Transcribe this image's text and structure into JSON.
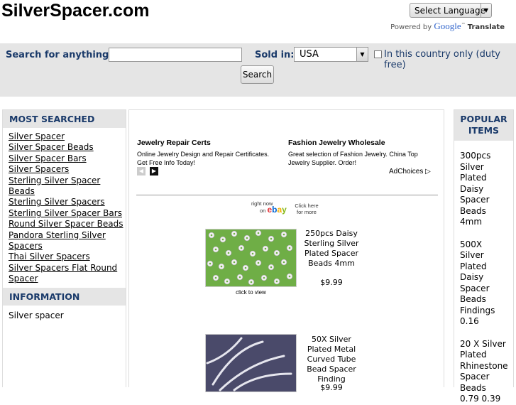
{
  "header": {
    "site_title": "SilverSpacer.com",
    "language_label": "Select Language",
    "powered_by": "Powered by",
    "google": "Google",
    "translate": "Translate"
  },
  "search": {
    "label": "Search for anything:",
    "input_value": "",
    "sold_in_label": "Sold in:",
    "country": "USA",
    "checkbox_label": "In this country only (duty free)",
    "button_label": "Search"
  },
  "sidebar": {
    "most_searched_title": "MOST SEARCHED",
    "links": [
      "Silver Spacer",
      "Silver Spacer Beads",
      "Silver Spacer Bars",
      "Silver Spacers",
      "Sterling Silver Spacer Beads",
      "Sterling Silver Spacers",
      "Sterling Silver Spacer Bars",
      "Round Silver Spacer Beads",
      "Pandora Sterling Silver Spacers",
      "Thai Silver Spacers",
      "Silver Spacers Flat Round Spacer"
    ],
    "information_title": "INFORMATION",
    "information_text": "Silver spacer"
  },
  "ads": [
    {
      "title": "Jewelry Repair Certs",
      "desc": "Online Jewelry Design and Repair Certificates. Get Free Info Today!"
    },
    {
      "title": "Fashion Jewelry Wholesale",
      "desc": "Great selection of Fashion Jewelry. China Top Jewelry Supplier. Order!"
    }
  ],
  "adchoices": "AdChoices",
  "ebay": {
    "right_now": "right now",
    "on": "on",
    "click_here": "Click here",
    "for_more": "for more"
  },
  "products": [
    {
      "title": "250pcs Daisy Sterling Silver Plated Spacer Beads 4mm",
      "price": "$9.99",
      "click_to_view": "click to view"
    },
    {
      "title": "50X Silver Plated Metal Curved Tube Bead Spacer Finding",
      "price": "$9.99"
    }
  ],
  "popular": {
    "title": "POPULAR ITEMS",
    "items": [
      "300pcs Silver Plated Daisy Spacer Beads 4mm",
      "500X Silver Plated Daisy Spacer Beads Findings 0.16",
      "20 X Silver Plated Rhinestone Spacer Beads 0.79 0.39"
    ]
  }
}
